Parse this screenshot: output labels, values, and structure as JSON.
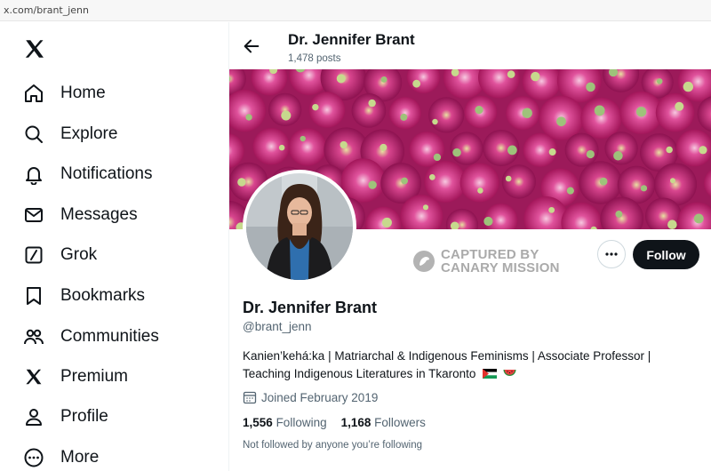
{
  "browser": {
    "url": "x.com/brant_jenn"
  },
  "sidebar": {
    "logo_icon": "x-logo-icon",
    "items": [
      {
        "label": "Home",
        "icon": "home-icon"
      },
      {
        "label": "Explore",
        "icon": "search-icon"
      },
      {
        "label": "Notifications",
        "icon": "bell-icon"
      },
      {
        "label": "Messages",
        "icon": "envelope-icon"
      },
      {
        "label": "Grok",
        "icon": "grok-icon"
      },
      {
        "label": "Bookmarks",
        "icon": "bookmark-icon"
      },
      {
        "label": "Communities",
        "icon": "people-icon"
      },
      {
        "label": "Premium",
        "icon": "x-logo-icon"
      },
      {
        "label": "Profile",
        "icon": "person-icon"
      },
      {
        "label": "More",
        "icon": "more-circle-icon"
      }
    ]
  },
  "header": {
    "name": "Dr. Jennifer Brant",
    "posts": "1,478 posts"
  },
  "profile": {
    "name": "Dr. Jennifer Brant",
    "handle": "@brant_jenn",
    "bio_line1": "Kanien’kehá:ka | Matriarchal & Indigenous Feminisms | Associate Professor |",
    "bio_line2": "Teaching Indigenous Literatures in Tkaronto",
    "joined": "Joined February 2019",
    "following_count": "1,556",
    "following_label": "Following",
    "followers_count": "1,168",
    "followers_label": "Followers",
    "not_followed": "Not followed by anyone you’re following"
  },
  "actions": {
    "follow_label": "Follow"
  },
  "watermark": {
    "line1": "CAPTURED BY",
    "line2": "CANARY MISSION"
  },
  "colors": {
    "text": "#0f1419",
    "secondary": "#536471",
    "banner": "#c0267a"
  }
}
